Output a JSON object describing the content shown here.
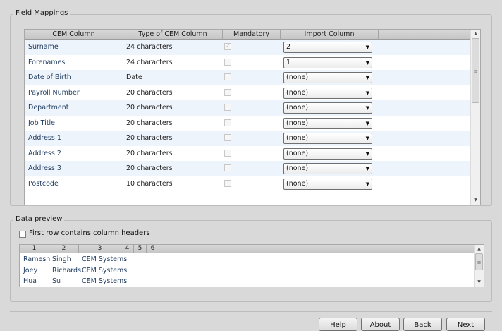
{
  "field_mappings": {
    "title": "Field Mappings",
    "columns": [
      "CEM Column",
      "Type of CEM Column",
      "Mandatory",
      "Import Column"
    ],
    "rows": [
      {
        "column": "Surname",
        "type": "24 characters",
        "mandatory": true,
        "import": "2"
      },
      {
        "column": "Forenames",
        "type": "24 characters",
        "mandatory": false,
        "import": "1"
      },
      {
        "column": "Date of Birth",
        "type": "Date",
        "mandatory": false,
        "import": "(none)"
      },
      {
        "column": "Payroll Number",
        "type": "20 characters",
        "mandatory": false,
        "import": "(none)"
      },
      {
        "column": "Department",
        "type": "20 characters",
        "mandatory": false,
        "import": "(none)"
      },
      {
        "column": "Job Title",
        "type": "20 characters",
        "mandatory": false,
        "import": "(none)"
      },
      {
        "column": "Address 1",
        "type": "20 characters",
        "mandatory": false,
        "import": "(none)"
      },
      {
        "column": "Address 2",
        "type": "20 characters",
        "mandatory": false,
        "import": "(none)"
      },
      {
        "column": "Address 3",
        "type": "20 characters",
        "mandatory": false,
        "import": "(none)"
      },
      {
        "column": "Postcode",
        "type": "10 characters",
        "mandatory": false,
        "import": "(none)"
      }
    ]
  },
  "data_preview": {
    "title": "Data preview",
    "first_row_headers_label": "First row contains column headers",
    "first_row_headers_checked": false,
    "columns": [
      "1",
      "2",
      "3",
      "4",
      "5",
      "6"
    ],
    "rows": [
      [
        "Ramesh",
        "Singh",
        "CEM Systems"
      ],
      [
        "Joey",
        "Richards",
        "CEM Systems"
      ],
      [
        "Hua",
        "Su",
        "CEM Systems"
      ]
    ]
  },
  "buttons": {
    "help": "Help",
    "about": "About",
    "back": "Back",
    "next": "Next"
  },
  "icons": {
    "dropdown_arrow": "▼",
    "scroll_up": "▲",
    "scroll_down": "▼",
    "scroll_grip": "≡",
    "check": "✓"
  }
}
